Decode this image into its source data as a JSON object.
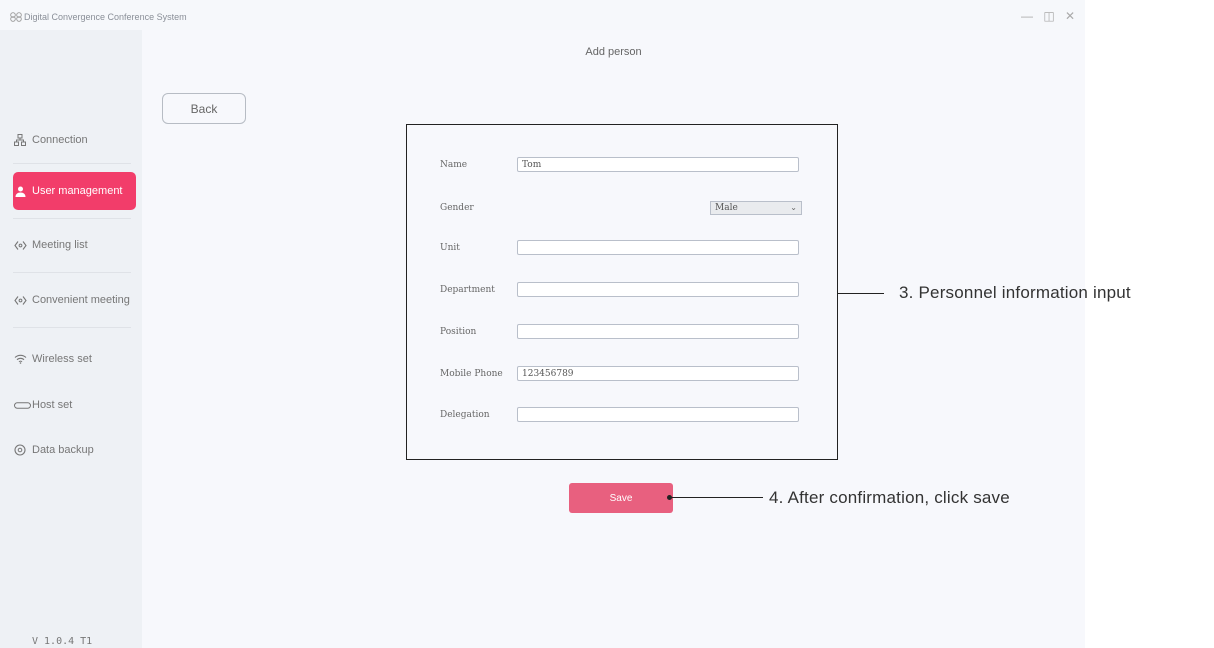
{
  "window": {
    "title": "Digital Convergence Conference System",
    "minimize": "—",
    "restore": "◫",
    "close": "✕"
  },
  "sidebar": {
    "items": [
      {
        "label": "Connection",
        "icon": "connection-icon"
      },
      {
        "label": "User management",
        "icon": "user-icon",
        "active": true
      },
      {
        "label": "Meeting list",
        "icon": "meeting-icon"
      },
      {
        "label": "Convenient meeting",
        "icon": "meeting-icon"
      },
      {
        "label": "Wireless set",
        "icon": "wifi-icon"
      },
      {
        "label": "Host set",
        "icon": "host-icon"
      },
      {
        "label": "Data backup",
        "icon": "backup-icon"
      }
    ],
    "version": "V 1.0.4 T1",
    "active_color": "#f23d6a"
  },
  "main": {
    "page_title": "Add person",
    "back_label": "Back",
    "save_label": "Save",
    "save_color": "#e8607f"
  },
  "form": {
    "name_label": "Name",
    "name_value": "Tom",
    "gender_label": "Gender",
    "gender_value": "Male",
    "unit_label": "Unit",
    "unit_value": "",
    "department_label": "Department",
    "department_value": "",
    "position_label": "Position",
    "position_value": "",
    "mobile_label": "Mobile Phone",
    "mobile_value": "123456789",
    "delegation_label": "Delegation",
    "delegation_value": ""
  },
  "annotations": {
    "step3": "3. Personnel information input",
    "step4": "4. After confirmation, click save"
  }
}
